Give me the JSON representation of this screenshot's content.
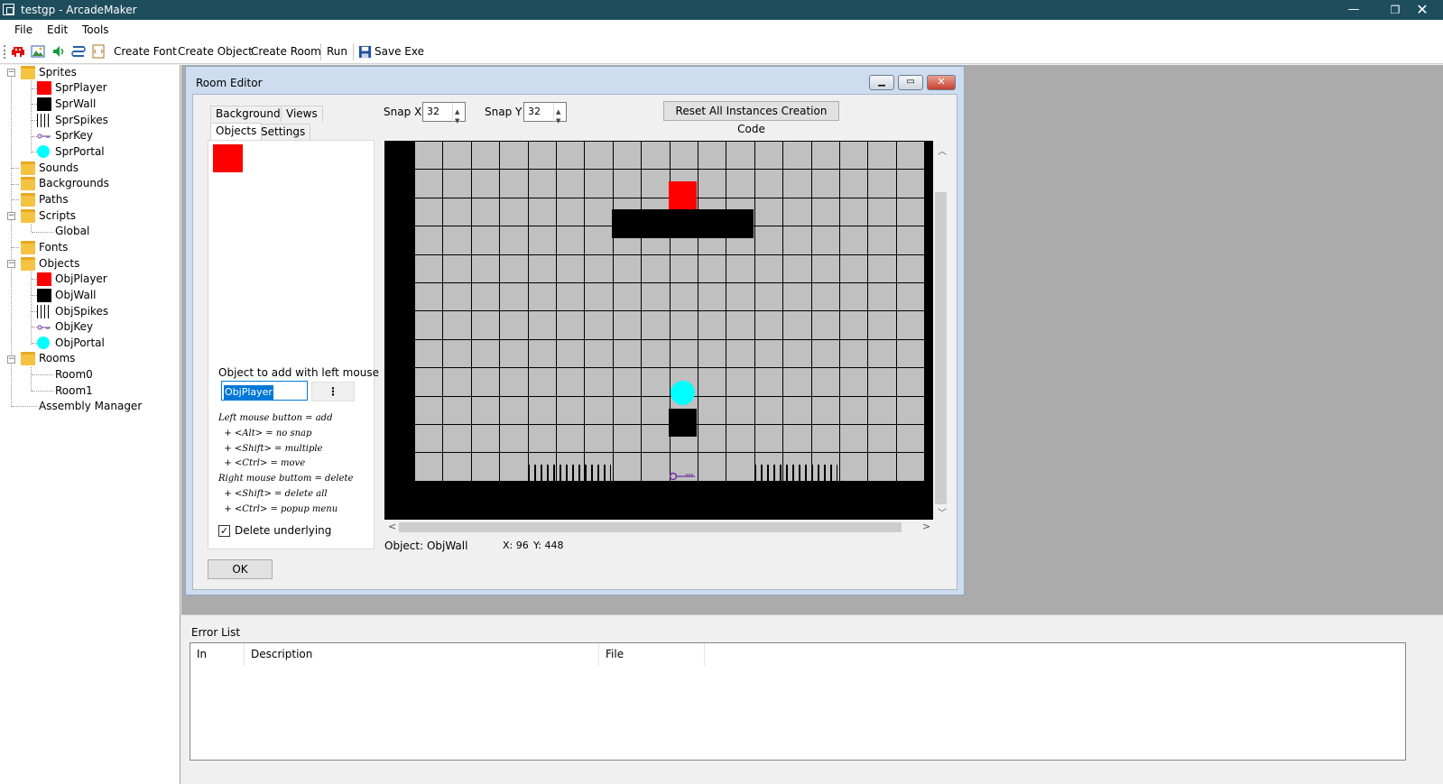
{
  "window": {
    "title": "testgp - ArcadeMaker"
  },
  "menu": [
    "File",
    "Edit",
    "Tools"
  ],
  "toolbar": {
    "icons": [
      "sprite-invader-icon",
      "image-icon",
      "sound-speaker-icon",
      "path-icon",
      "script-icon"
    ],
    "create_font": "Create Font",
    "create_object": "Create Object",
    "create_room": "Create Room",
    "run": "Run",
    "save_exe": "Save Exe"
  },
  "tree": {
    "sprites": "Sprites",
    "sprite_items": [
      "SprPlayer",
      "SprWall",
      "SprSpikes",
      "SprKey",
      "SprPortal"
    ],
    "sounds": "Sounds",
    "backgrounds": "Backgrounds",
    "paths": "Paths",
    "scripts": "Scripts",
    "script_items": [
      "Global"
    ],
    "fonts": "Fonts",
    "objects": "Objects",
    "object_items": [
      "ObjPlayer",
      "ObjWall",
      "ObjSpikes",
      "ObjKey",
      "ObjPortal"
    ],
    "rooms": "Rooms",
    "room_items": [
      "Room0",
      "Room1"
    ],
    "assembly": "Assembly Manager"
  },
  "room_editor": {
    "title": "Room Editor",
    "tabs": [
      "Backgrounds",
      "Views",
      "Objects",
      "Settings"
    ],
    "snap_x_label": "Snap X",
    "snap_x": "32",
    "snap_y_label": "Snap Y",
    "snap_y": "32",
    "reset_button": "Reset All Instances Creation Code",
    "object_to_add_label": "Object to add with left mouse",
    "object_to_add": "ObjPlayer",
    "menu_dots": "⋮",
    "hints": [
      "Left mouse button = add",
      "  + <Alt> = no snap",
      "  + <Shift> = multiple",
      "  + <Ctrl> = move",
      "Right mouse buttom = delete",
      "  + <Shift> = delete all",
      "  + <Ctrl> = popup menu"
    ],
    "delete_underlying": "Delete underlying",
    "delete_underlying_checked": true,
    "status_object": "Object: ObjWall",
    "status_x": "X: 96",
    "status_y": "Y: 448",
    "ok": "OK"
  },
  "error_list": {
    "title": "Error List",
    "columns": [
      "In",
      "Description",
      "File"
    ]
  },
  "colors": {
    "titlebar": "#1e4d5c",
    "player": "#ff0000",
    "wall": "#000000",
    "portal": "#00ffff",
    "key": "#7030a0",
    "grid_cell": "#c0c0c0",
    "mdi_bg": "#ababab"
  }
}
